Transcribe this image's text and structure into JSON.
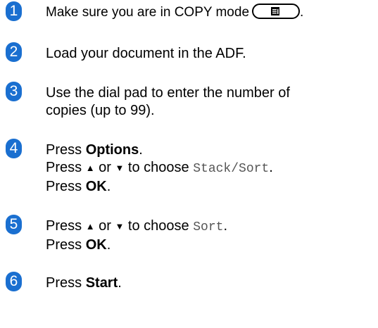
{
  "accent_color": "#1a6fd0",
  "steps": [
    {
      "number": "1",
      "text_before": "Make sure you are in COPY mode",
      "button_icon": "copy-mode-icon",
      "text_after": "."
    },
    {
      "number": "2",
      "line": "Load your document in the ADF."
    },
    {
      "number": "3",
      "line1": "Use the dial pad to enter the number of",
      "line2": "copies (up to 99)."
    },
    {
      "number": "4",
      "press": "Press",
      "options": "Options",
      "period": ".",
      "or": "or",
      "to_choose": "to choose",
      "stack_sort": "Stack/Sort",
      "ok": "OK"
    },
    {
      "number": "5",
      "press": "Press",
      "or": "or",
      "to_choose": "to choose",
      "sort": "Sort",
      "period": ".",
      "ok": "OK"
    },
    {
      "number": "6",
      "press": "Press",
      "start": "Start",
      "period": "."
    }
  ]
}
